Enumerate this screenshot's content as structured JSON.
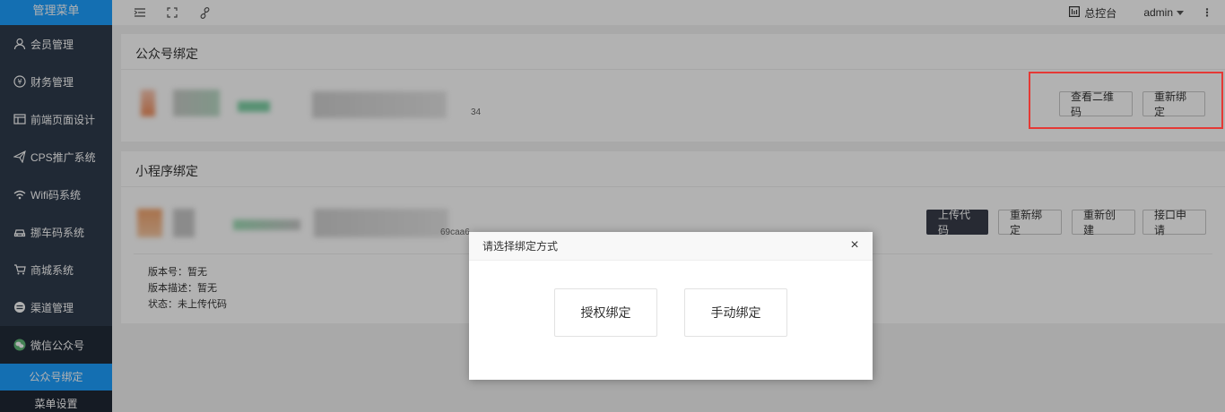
{
  "sidebar": {
    "brand": "管理菜单",
    "items": [
      {
        "label": "会员管理",
        "icon": "user-icon"
      },
      {
        "label": "财务管理",
        "icon": "yen-icon"
      },
      {
        "label": "前端页面设计",
        "icon": "layout-icon"
      },
      {
        "label": "CPS推广系统",
        "icon": "paper-plane-icon"
      },
      {
        "label": "Wifi码系统",
        "icon": "wifi-icon"
      },
      {
        "label": "挪车码系统",
        "icon": "car-icon"
      },
      {
        "label": "商城系统",
        "icon": "cart-icon"
      },
      {
        "label": "渠道管理",
        "icon": "channel-icon"
      },
      {
        "label": "微信公众号",
        "icon": "wechat-icon"
      }
    ],
    "subitems": [
      {
        "label": "公众号绑定"
      },
      {
        "label": "菜单设置"
      }
    ]
  },
  "topbar": {
    "console_label": "总控台",
    "user_label": "admin"
  },
  "official_account": {
    "title": "公众号绑定",
    "id_suffix": "34",
    "buttons": {
      "qrcode": "查看二维码",
      "rebind": "重新绑定"
    }
  },
  "mini_program": {
    "title": "小程序绑定",
    "id_fragment": "69caa6",
    "buttons": {
      "upload": "上传代码",
      "rebind": "重新绑定",
      "recreate": "重新创建",
      "apply": "接口申请"
    },
    "version_label": "版本号：暂无",
    "description_label": "版本描述：暂无",
    "status_label": "状态：未上传代码"
  },
  "dialog": {
    "title": "请选择绑定方式",
    "close_symbol": "×",
    "options": {
      "authorize": "授权绑定",
      "manual": "手动绑定"
    }
  },
  "colors": {
    "sidebar_bg": "#2f3b4c",
    "accent": "#1e9fff",
    "highlight_border": "#e53935",
    "dark_button": "#393d49"
  }
}
